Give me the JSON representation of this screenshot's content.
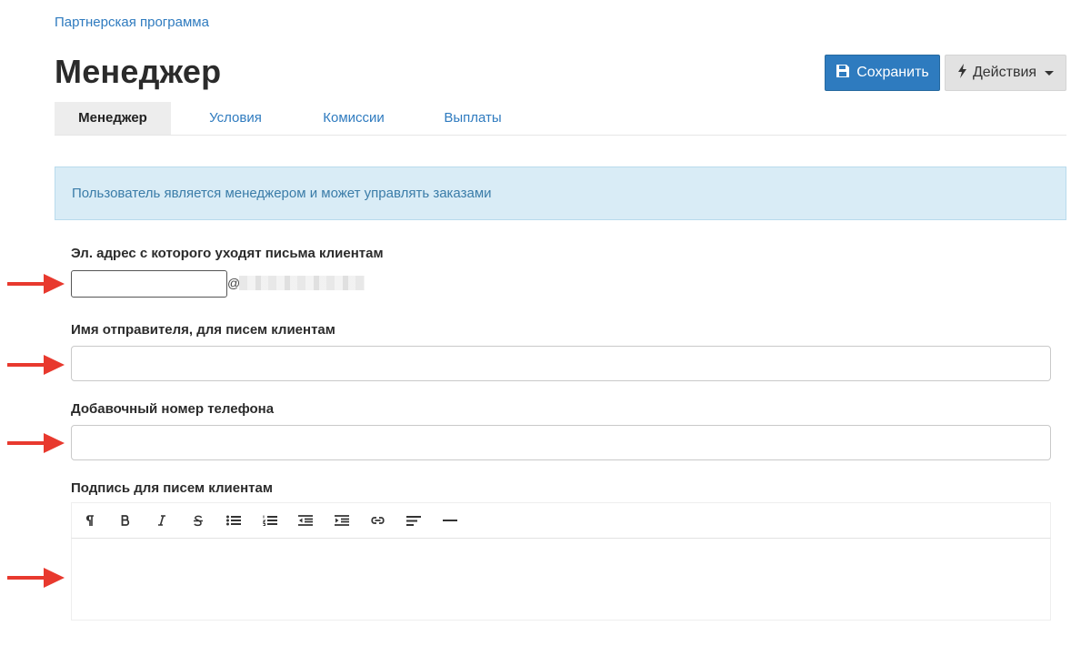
{
  "breadcrumb": "Партнерская программа",
  "title": "Менеджер",
  "toolbar": {
    "save_label": "Сохранить",
    "save_icon": "floppy-disk-icon",
    "actions_label": "Действия",
    "actions_icon": "lightning-icon"
  },
  "tabs": [
    {
      "label": "Менеджер",
      "active": true
    },
    {
      "label": "Условия",
      "active": false
    },
    {
      "label": "Комиссии",
      "active": false
    },
    {
      "label": "Выплаты",
      "active": false
    }
  ],
  "alert": "Пользователь является менеджером и может управлять заказами",
  "fields": {
    "email_label": "Эл. адрес с которого уходят письма клиентам",
    "email_value": "",
    "email_at": "@",
    "sender_label": "Имя отправителя, для писем клиентам",
    "sender_value": "",
    "phone_label": "Добавочный номер телефона",
    "phone_value": "",
    "signature_label": "Подпись для писем клиентам",
    "signature_value": ""
  },
  "editor_tools": [
    "paragraph-icon",
    "bold-icon",
    "italic-icon",
    "strikethrough-icon",
    "bulleted-list-icon",
    "numbered-list-icon",
    "outdent-icon",
    "indent-icon",
    "link-icon",
    "align-left-icon",
    "horizontal-rule-icon"
  ],
  "colors": {
    "accent": "#2e7bbf",
    "alert_bg": "#d9ecf6",
    "annotation_arrow": "#e8392e"
  }
}
